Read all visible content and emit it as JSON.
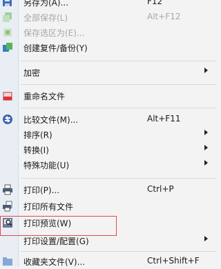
{
  "menu": {
    "items": [
      {
        "label": "另存为(A)...",
        "shortcut": "F12",
        "icon": "save-as-icon",
        "disabled": false
      },
      {
        "label": "全部保存(L)",
        "shortcut": "Alt+F12",
        "icon": "save-all-icon",
        "disabled": true
      },
      {
        "label": "保存选区为(E)...",
        "shortcut": "",
        "icon": "save-selection-icon",
        "disabled": true
      },
      {
        "label": "创建复件/备份(Y)",
        "shortcut": "",
        "icon": "backup-icon",
        "disabled": false
      },
      {
        "label": "加密",
        "shortcut": "",
        "icon": "",
        "disabled": false,
        "submenu": true
      },
      {
        "label": "重命名文件",
        "shortcut": "",
        "icon": "rename-file-icon",
        "disabled": false
      },
      {
        "label": "比较文件(M)...",
        "shortcut": "Alt+F11",
        "icon": "compare-icon",
        "disabled": false
      },
      {
        "label": "排序(R)",
        "shortcut": "",
        "icon": "",
        "disabled": false,
        "submenu": true
      },
      {
        "label": "转换(I)",
        "shortcut": "",
        "icon": "",
        "disabled": false,
        "submenu": true
      },
      {
        "label": "特殊功能(U)",
        "shortcut": "",
        "icon": "",
        "disabled": false,
        "submenu": true
      },
      {
        "label": "打印(P)...",
        "shortcut": "Ctrl+P",
        "icon": "printer-icon",
        "disabled": false
      },
      {
        "label": "打印所有文件",
        "shortcut": "",
        "icon": "print-all-icon",
        "disabled": false
      },
      {
        "label": "打印预览(W)",
        "shortcut": "",
        "icon": "print-preview-icon",
        "disabled": false,
        "highlighted": true
      },
      {
        "label": "打印设置/配置(G)",
        "shortcut": "",
        "icon": "",
        "disabled": false,
        "submenu": true
      },
      {
        "label": "收藏夹文件(V)...",
        "shortcut": "Ctrl+Shift+F",
        "icon": "favorites-folder-icon",
        "disabled": false
      }
    ]
  },
  "colors": {
    "highlight_border": "#e04848",
    "disabled_text": "#a7a7a7",
    "menu_background": "#f3f3f3"
  }
}
